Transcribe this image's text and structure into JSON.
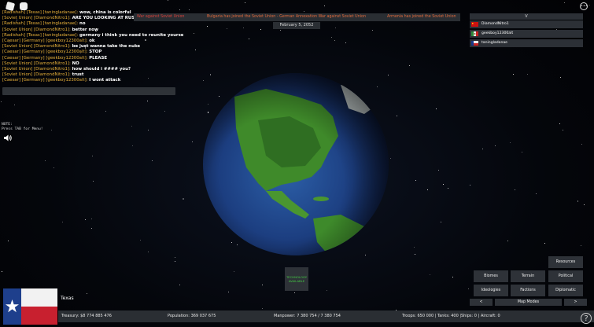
{
  "chat": {
    "lines": [
      {
        "name": "[Radishah] [Texas] [taningladanae]:",
        "msg": "wow, china is colorful"
      },
      {
        "name": "[Soviet Union] [DiamondNitro1]:",
        "msg": "ARE YOU LOOKING AT RUSSIA"
      },
      {
        "name": "[Radishah] [Texas] [taningladanae]:",
        "msg": "no"
      },
      {
        "name": "[Soviet Union] [DiamondNitro1]:",
        "msg": "better now"
      },
      {
        "name": "[Radishah] [Texas] [taningladanae]:",
        "msg": "germany i think you need to reunite yourself"
      },
      {
        "name": "[Caesar] [Germany] [geekboy12300alt]:",
        "msg": "ok"
      },
      {
        "name": "[Soviet Union] [DiamondNitro1]:",
        "msg": "be just wanna take the nuke"
      },
      {
        "name": "[Caesar] [Germany] [geekboy12300alt]:",
        "msg": "STOP"
      },
      {
        "name": "[Caesar] [Germany] [geekboy12300alt]:",
        "msg": "PLEASE"
      },
      {
        "name": "[Soviet Union] [DiamondNitro1]:",
        "msg": "NO"
      },
      {
        "name": "[Soviet Union] [DiamondNitro1]:",
        "msg": "how should i #### you?"
      },
      {
        "name": "[Soviet Union] [DiamondNitro1]:",
        "msg": "trust"
      },
      {
        "name": "[Caesar] [Germany] [geekboy12300alt]:",
        "msg": "I wont attack"
      }
    ]
  },
  "ticker": {
    "item1": "War against Soviet Union",
    "item2": "Bulgaria has joined the Soviet Union - German Annexation War against Soviet Union",
    "item3": "Armenia has joined the Soviet Union"
  },
  "date": "February 5, 2052",
  "players": {
    "header": "V",
    "list": [
      {
        "name": "DiamondNitro1"
      },
      {
        "name": "geekboy12300alt"
      },
      {
        "name": "taningladanae"
      }
    ]
  },
  "note": {
    "line1": "NOTE:",
    "line2": "Press TAB for Menu!"
  },
  "tech": {
    "line1": "TECHNOLOGY",
    "line2": "AVAILABLE"
  },
  "map_modes": {
    "resources": "Resources",
    "biomes": "Biomes",
    "terrain": "Terrain",
    "political": "Political",
    "ideologies": "Ideologies",
    "factions": "Factions",
    "diplomatic": "Diplomatic",
    "prev": "<",
    "label": "Map Modes",
    "next": ">"
  },
  "country": {
    "name": "Texas",
    "treasury_label": "Treasury:",
    "treasury": "$8 774 885 476",
    "population_label": "Population:",
    "population": "369 037 675",
    "manpower_label": "Manpower:",
    "manpower": "7 380 754  /  7 380 754",
    "troops_label": "Troops:",
    "troops": "650 000",
    "tanks_label": "Tanks:",
    "tanks": "400",
    "ships_label": "Ships:",
    "ships": "0",
    "aircraft_label": "Aircraft:",
    "aircraft": "0"
  },
  "help": "?",
  "colors": {
    "chat_name": "#e8b13a",
    "war": "#d9423b",
    "tech_green": "#44cc44",
    "panel": "#2a2e33"
  }
}
